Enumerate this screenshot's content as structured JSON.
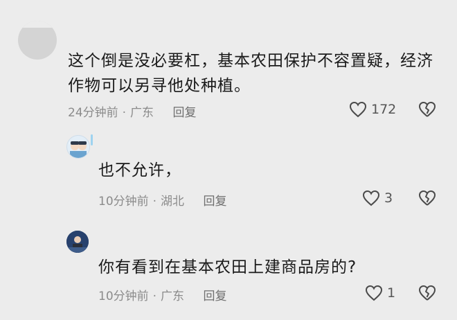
{
  "comments": [
    {
      "text_line1": "这个倒是没必要杠，基本农田保护不容置疑，经济",
      "text_line2": "作物可以另寻他处种植。",
      "time": "24分钟前",
      "location": "广东",
      "reply_label": "回复",
      "likes": "172"
    },
    {
      "text": "也不允许，",
      "time": "10分钟前",
      "location": "湖北",
      "reply_label": "回复",
      "likes": "3"
    },
    {
      "text": "你有看到在基本农田上建商品房的?",
      "time": "10分钟前",
      "location": "广东",
      "reply_label": "回复",
      "likes": "1"
    }
  ],
  "separator": "·",
  "icons": {
    "like": "heart-outline-icon",
    "dislike": "broken-heart-icon"
  }
}
